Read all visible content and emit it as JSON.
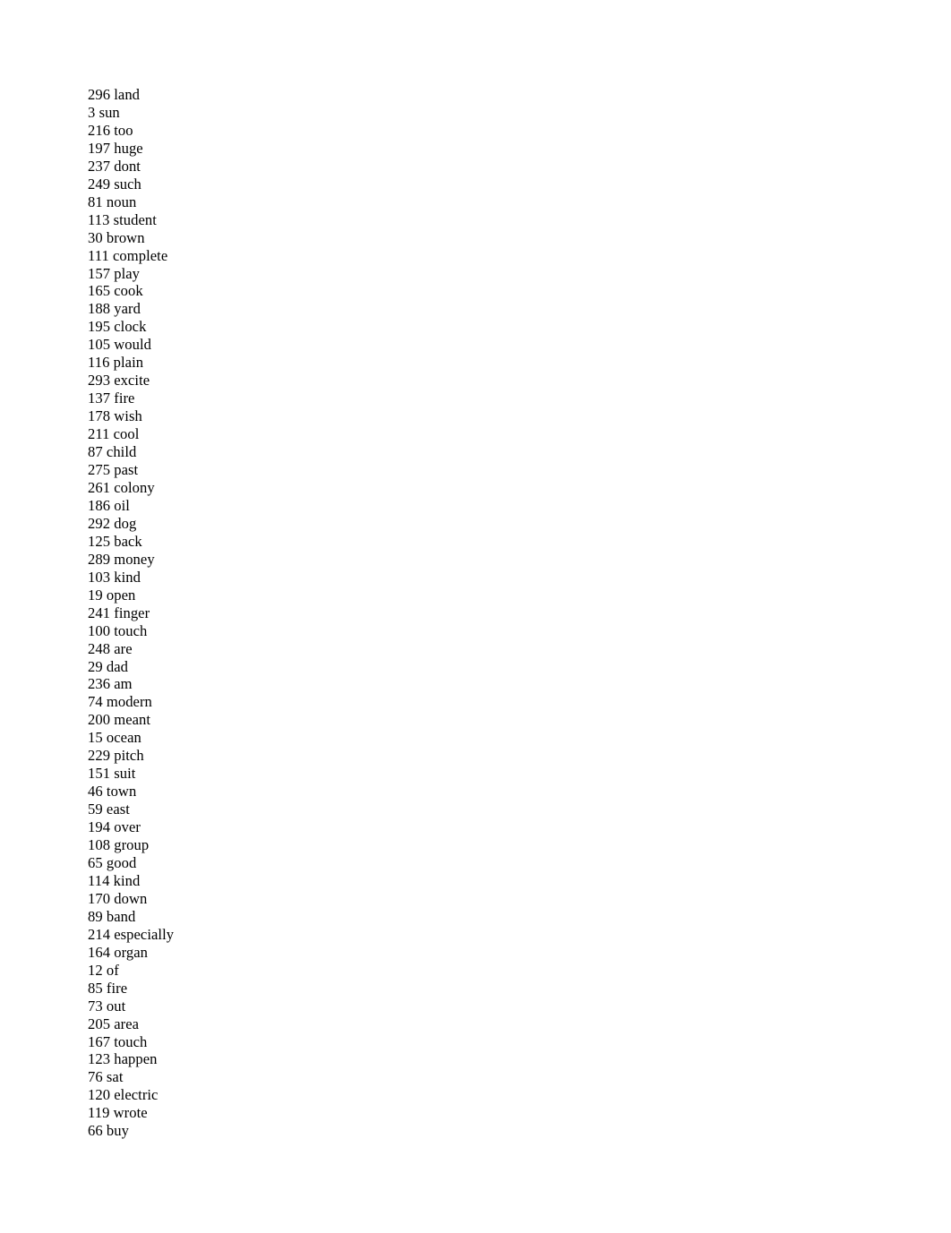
{
  "document": {
    "background_color": "#ffffff",
    "text_color": "#000000",
    "entries": [
      {
        "count": "296",
        "word": "land",
        "line": "296 land"
      },
      {
        "count": "3",
        "word": "sun",
        "line": "3 sun"
      },
      {
        "count": "216",
        "word": "too",
        "line": "216 too"
      },
      {
        "count": "197",
        "word": "huge",
        "line": "197 huge"
      },
      {
        "count": "237",
        "word": "dont",
        "line": "237 dont"
      },
      {
        "count": "249",
        "word": "such",
        "line": "249 such"
      },
      {
        "count": "81",
        "word": "noun",
        "line": "81 noun"
      },
      {
        "count": "113",
        "word": "student",
        "line": "113 student"
      },
      {
        "count": "30",
        "word": "brown",
        "line": "30 brown"
      },
      {
        "count": "111",
        "word": "complete",
        "line": "111 complete"
      },
      {
        "count": "157",
        "word": "play",
        "line": "157 play"
      },
      {
        "count": "165",
        "word": "cook",
        "line": "165 cook"
      },
      {
        "count": "188",
        "word": "yard",
        "line": "188 yard"
      },
      {
        "count": "195",
        "word": "clock",
        "line": "195 clock"
      },
      {
        "count": "105",
        "word": "would",
        "line": "105 would"
      },
      {
        "count": "116",
        "word": "plain",
        "line": "116 plain"
      },
      {
        "count": "293",
        "word": "excite",
        "line": "293 excite"
      },
      {
        "count": "137",
        "word": "fire",
        "line": "137 fire"
      },
      {
        "count": "178",
        "word": "wish",
        "line": "178 wish"
      },
      {
        "count": "211",
        "word": "cool",
        "line": "211 cool"
      },
      {
        "count": "87",
        "word": "child",
        "line": "87 child"
      },
      {
        "count": "275",
        "word": "past",
        "line": "275 past"
      },
      {
        "count": "261",
        "word": "colony",
        "line": "261 colony"
      },
      {
        "count": "186",
        "word": "oil",
        "line": "186 oil"
      },
      {
        "count": "292",
        "word": "dog",
        "line": "292 dog"
      },
      {
        "count": "125",
        "word": "back",
        "line": "125 back"
      },
      {
        "count": "289",
        "word": "money",
        "line": "289 money"
      },
      {
        "count": "103",
        "word": "kind",
        "line": "103 kind"
      },
      {
        "count": "19",
        "word": "open",
        "line": "19 open"
      },
      {
        "count": "241",
        "word": "finger",
        "line": "241 finger"
      },
      {
        "count": "100",
        "word": "touch",
        "line": "100 touch"
      },
      {
        "count": "248",
        "word": "are",
        "line": "248 are"
      },
      {
        "count": "29",
        "word": "dad",
        "line": "29 dad"
      },
      {
        "count": "236",
        "word": "am",
        "line": "236 am"
      },
      {
        "count": "74",
        "word": "modern",
        "line": "74 modern"
      },
      {
        "count": "200",
        "word": "meant",
        "line": "200 meant"
      },
      {
        "count": "15",
        "word": "ocean",
        "line": "15 ocean"
      },
      {
        "count": "229",
        "word": "pitch",
        "line": "229 pitch"
      },
      {
        "count": "151",
        "word": "suit",
        "line": "151 suit"
      },
      {
        "count": "46",
        "word": "town",
        "line": "46 town"
      },
      {
        "count": "59",
        "word": "east",
        "line": "59 east"
      },
      {
        "count": "194",
        "word": "over",
        "line": "194 over"
      },
      {
        "count": "108",
        "word": "group",
        "line": "108 group"
      },
      {
        "count": "65",
        "word": "good",
        "line": "65 good"
      },
      {
        "count": "114",
        "word": "kind",
        "line": "114 kind"
      },
      {
        "count": "170",
        "word": "down",
        "line": "170 down"
      },
      {
        "count": "89",
        "word": "band",
        "line": "89 band"
      },
      {
        "count": "214",
        "word": "especially",
        "line": "214 especially"
      },
      {
        "count": "164",
        "word": "organ",
        "line": "164 organ"
      },
      {
        "count": "12",
        "word": "of",
        "line": "12 of"
      },
      {
        "count": "85",
        "word": "fire",
        "line": "85 fire"
      },
      {
        "count": "73",
        "word": "out",
        "line": "73 out"
      },
      {
        "count": "205",
        "word": "area",
        "line": "205 area"
      },
      {
        "count": "167",
        "word": "touch",
        "line": "167 touch"
      },
      {
        "count": "123",
        "word": "happen",
        "line": "123 happen"
      },
      {
        "count": "76",
        "word": "sat",
        "line": "76 sat"
      },
      {
        "count": "120",
        "word": "electric",
        "line": "120 electric"
      },
      {
        "count": "119",
        "word": "wrote",
        "line": "119 wrote"
      },
      {
        "count": "66",
        "word": "buy",
        "line": "66 buy"
      }
    ]
  }
}
